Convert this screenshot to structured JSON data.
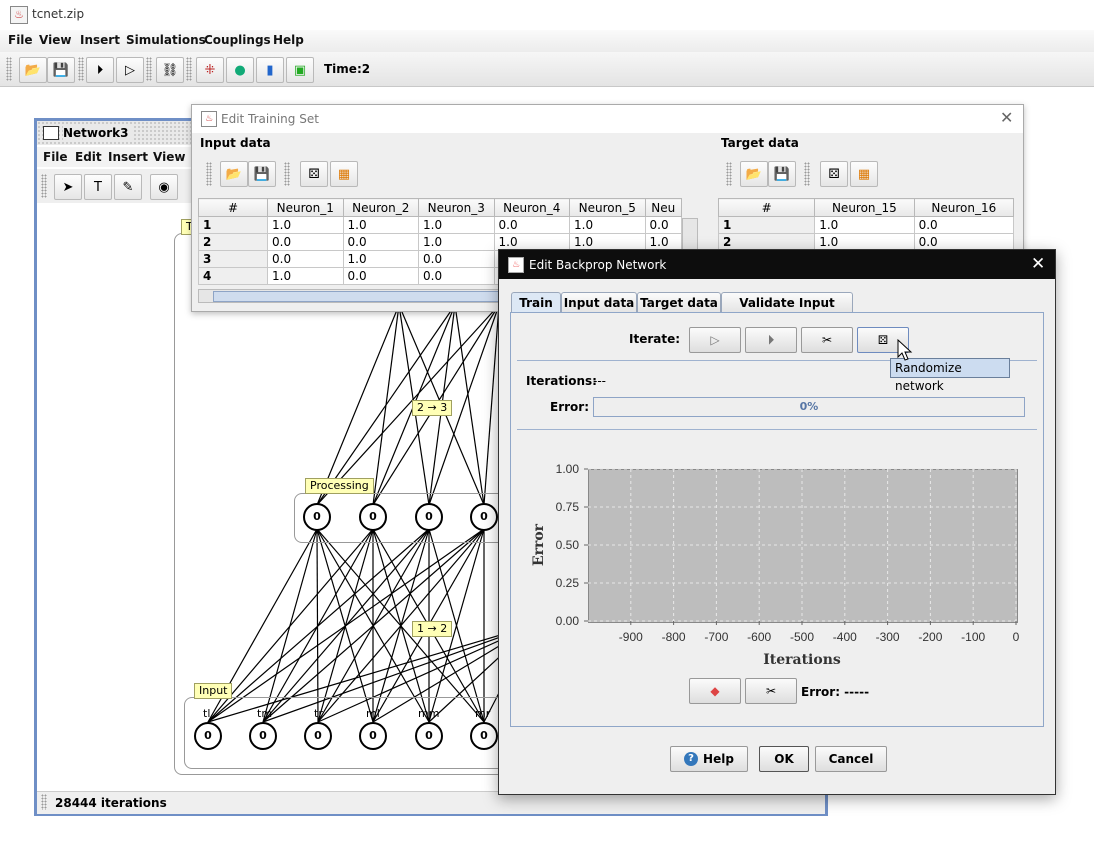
{
  "app": {
    "title": "tcnet.zip"
  },
  "menubar": [
    "File",
    "View",
    "Insert",
    "Simulations",
    "Couplings",
    "Help"
  ],
  "toolbar": {
    "time_label": "Time:2"
  },
  "network_window": {
    "title": "Network3",
    "menu": [
      "File",
      "Edit",
      "Insert",
      "View"
    ],
    "status": "28444 iterations",
    "group_labels": {
      "top": "T",
      "processing": "Processing",
      "input": "Input"
    },
    "synapse_labels": {
      "upper": "2 → 3",
      "lower": "1 → 2"
    },
    "processing_neurons": [
      "0",
      "0",
      "0",
      "0"
    ],
    "input_neurons": [
      "0",
      "0",
      "0",
      "0",
      "0",
      "0"
    ],
    "input_labels": [
      "tl",
      "tm",
      "tr",
      "ml",
      "mm",
      "mr"
    ]
  },
  "training_set": {
    "title": "Edit Training Set",
    "input_label": "Input data",
    "target_label": "Target data",
    "input_table": {
      "headers": [
        "#",
        "Neuron_1",
        "Neuron_2",
        "Neuron_3",
        "Neuron_4",
        "Neuron_5",
        "Neu"
      ],
      "rows": [
        [
          "1",
          "1.0",
          "1.0",
          "1.0",
          "0.0",
          "1.0",
          "0.0"
        ],
        [
          "2",
          "0.0",
          "0.0",
          "1.0",
          "1.0",
          "1.0",
          "1.0"
        ],
        [
          "3",
          "0.0",
          "1.0",
          "0.0",
          "",
          "",
          ""
        ],
        [
          "4",
          "1.0",
          "0.0",
          "0.0",
          "",
          "",
          ""
        ]
      ]
    },
    "target_table": {
      "headers": [
        "#",
        "Neuron_15",
        "Neuron_16"
      ],
      "rows": [
        [
          "1",
          "1.0",
          "0.0"
        ],
        [
          "2",
          "1.0",
          "0.0"
        ]
      ]
    }
  },
  "backprop": {
    "title": "Edit Backprop Network",
    "tabs": [
      "Train",
      "Input data",
      "Target data",
      "Validate Input Data"
    ],
    "iterate_label": "Iterate:",
    "iterations_label": "Iterations:",
    "iterations_value": "---",
    "error_label": "Error:",
    "error_progress_text": "0%",
    "error_progress": 0,
    "tooltip": "Randomize network",
    "bottom_error": "Error: -----",
    "buttons": {
      "help": "Help",
      "ok": "OK",
      "cancel": "Cancel"
    }
  },
  "chart_data": {
    "type": "line",
    "title": "",
    "xlabel": "Iterations",
    "ylabel": "Error",
    "xlim": [
      -1000,
      0
    ],
    "ylim": [
      0,
      1
    ],
    "x_ticks": [
      "-900",
      "-800",
      "-700",
      "-600",
      "-500",
      "-400",
      "-300",
      "-200",
      "-100",
      "0"
    ],
    "y_ticks": [
      "0.00",
      "0.25",
      "0.50",
      "0.75",
      "1.00"
    ],
    "grid": true,
    "series": []
  }
}
